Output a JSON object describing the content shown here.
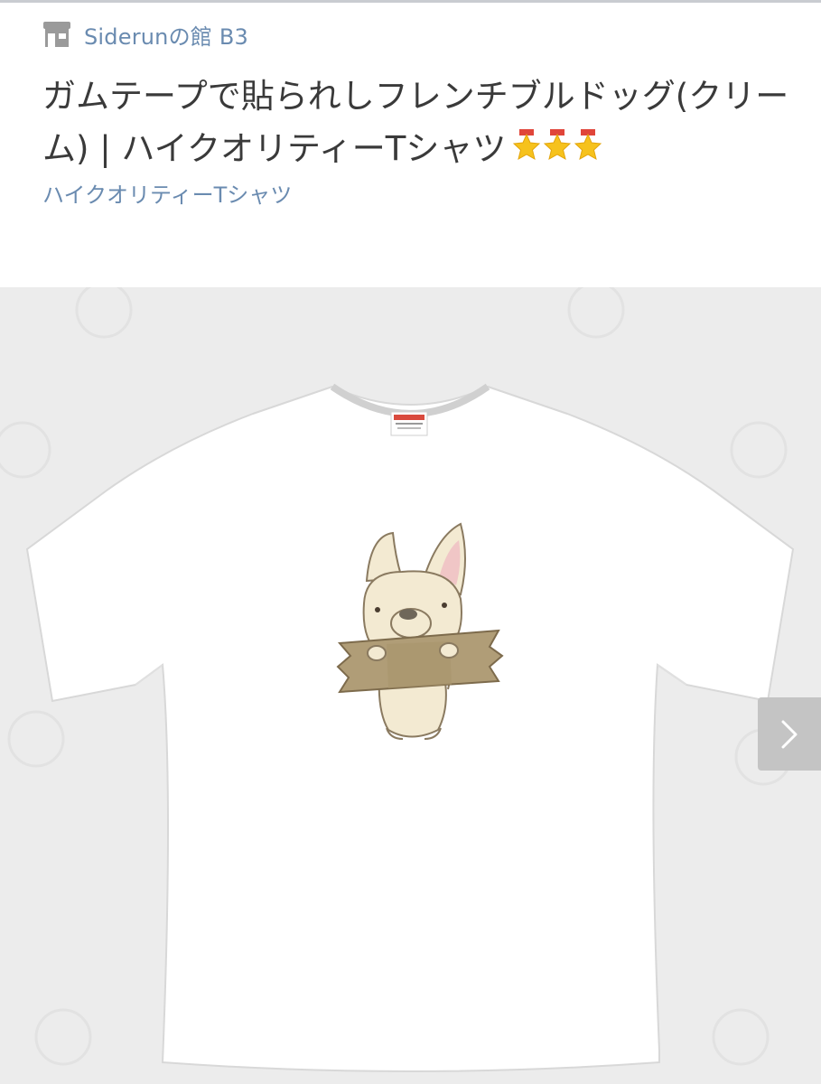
{
  "shop": {
    "name": "Siderunの館 B3",
    "icon": "store-icon"
  },
  "product": {
    "title": "ガムテープで貼られしフレンチブルドッグ(クリーム) | ハイクオリティーTシャツ",
    "rating_icons": [
      "star-icon",
      "star-icon",
      "star-icon"
    ],
    "category": "ハイクオリティーTシャツ"
  },
  "gallery": {
    "image_subject": "tshirt-icon",
    "next_icon": "chevron-right-icon"
  },
  "colors": {
    "link": "#6a8bb0",
    "text": "#3a3a3a",
    "gallery_bg": "#ececec",
    "star": "#f6c21c"
  }
}
